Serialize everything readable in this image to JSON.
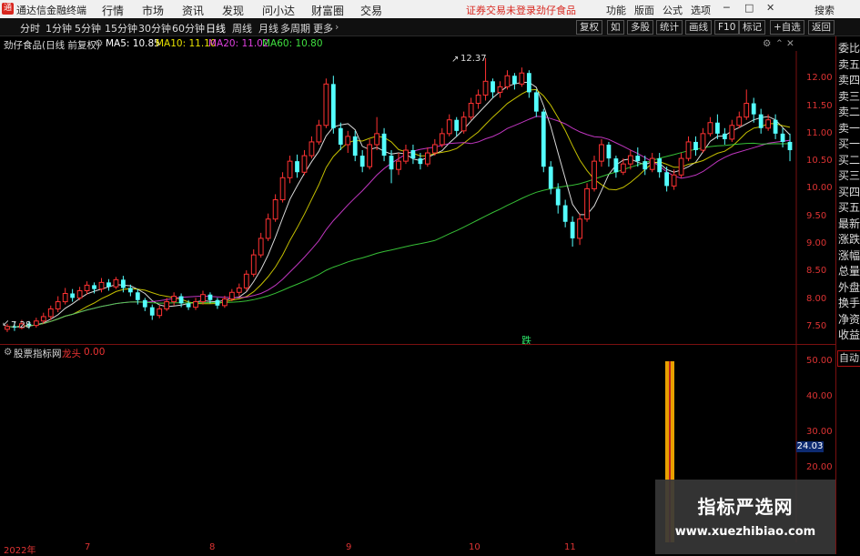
{
  "topbar": {
    "brand": "通达信金融终端",
    "menu": [
      "行情",
      "市场",
      "资讯",
      "发现",
      "问小达",
      "财富圈",
      "交易"
    ],
    "notice": "证券交易未登录",
    "stock": "劲仔食品",
    "right_menu": [
      "功能",
      "版面",
      "公式",
      "选项"
    ],
    "window_controls": [
      "─",
      "□",
      "✕"
    ],
    "search_label": "搜索"
  },
  "toolbar": {
    "periods": [
      "分时",
      "1分钟",
      "5分钟",
      "15分钟",
      "30分钟",
      "60分钟",
      "日线",
      "周线",
      "月线",
      "多周期",
      "更多"
    ],
    "active_period": "日线",
    "right_buttons": [
      "复权",
      "如",
      "多股",
      "统计",
      "画线",
      "F10",
      "标记",
      "+自选",
      "返回"
    ]
  },
  "infobar": {
    "title": "劲仔食品(日线 前复权)",
    "ma5": "MA5: 10.85",
    "ma10": "MA10: 11.10",
    "ma20": "MA20: 11.02",
    "ma60": "MA60: 10.80",
    "colors": {
      "ma5": "#ffffff",
      "ma10": "#e6e000",
      "ma20": "#e040e0",
      "ma60": "#40e040"
    }
  },
  "sidepanel": {
    "items": [
      "委比",
      "卖五",
      "卖四",
      "卖三",
      "卖二",
      "卖一",
      "买一",
      "买二",
      "买三",
      "买四",
      "买五",
      "最新",
      "涨跌",
      "涨幅",
      "总量",
      "外盘",
      "换手",
      "净资",
      "收益"
    ],
    "auto": "自动"
  },
  "price_axis": [
    "12.00",
    "11.50",
    "11.00",
    "10.50",
    "10.00",
    "9.50",
    "9.00",
    "8.50",
    "8.00",
    "7.50"
  ],
  "annotations": {
    "high": "12.37",
    "low": "7.28",
    "signal": "跌"
  },
  "indicator": {
    "name": "股票指标网",
    "param": "龙头",
    "value": "0.00",
    "axis": [
      "50.00",
      "40.00",
      "30.00",
      "20.00"
    ],
    "current_label": "24.03",
    "bar_value": 50
  },
  "x_axis": [
    "2022年",
    "7",
    "8",
    "9",
    "10",
    "11"
  ],
  "watermark": {
    "title": "指标严选网",
    "url": "www.xuezhibiao.com"
  },
  "chart_data": {
    "type": "candlestick",
    "ylim": [
      7.2,
      12.5
    ],
    "candles": [
      [
        7.45,
        7.5,
        7.4,
        7.55
      ],
      [
        7.5,
        7.48,
        7.42,
        7.58
      ],
      [
        7.48,
        7.55,
        7.45,
        7.62
      ],
      [
        7.55,
        7.52,
        7.46,
        7.6
      ],
      [
        7.52,
        7.6,
        7.48,
        7.66
      ],
      [
        7.6,
        7.68,
        7.55,
        7.75
      ],
      [
        7.68,
        7.82,
        7.62,
        7.88
      ],
      [
        7.82,
        7.95,
        7.76,
        8.05
      ],
      [
        7.95,
        8.1,
        7.9,
        8.2
      ],
      [
        8.1,
        8.02,
        7.95,
        8.18
      ],
      [
        8.02,
        8.15,
        7.98,
        8.22
      ],
      [
        8.15,
        8.25,
        8.08,
        8.32
      ],
      [
        8.25,
        8.18,
        8.1,
        8.3
      ],
      [
        8.18,
        8.3,
        8.12,
        8.38
      ],
      [
        8.3,
        8.22,
        8.15,
        8.36
      ],
      [
        8.22,
        8.35,
        8.18,
        8.4
      ],
      [
        8.35,
        8.2,
        8.12,
        8.42
      ],
      [
        8.2,
        8.12,
        8.05,
        8.26
      ],
      [
        8.12,
        7.98,
        7.9,
        8.18
      ],
      [
        7.98,
        7.85,
        7.78,
        8.02
      ],
      [
        7.85,
        7.7,
        7.62,
        7.9
      ],
      [
        7.7,
        7.82,
        7.65,
        7.88
      ],
      [
        7.82,
        7.95,
        7.78,
        8.02
      ],
      [
        7.95,
        8.05,
        7.88,
        8.12
      ],
      [
        8.05,
        7.92,
        7.85,
        8.1
      ],
      [
        7.92,
        7.85,
        7.8,
        7.98
      ],
      [
        7.85,
        7.95,
        7.8,
        8.02
      ],
      [
        7.95,
        8.08,
        7.9,
        8.15
      ],
      [
        8.08,
        7.98,
        7.92,
        8.12
      ],
      [
        7.98,
        7.88,
        7.82,
        8.02
      ],
      [
        7.88,
        8.0,
        7.84,
        8.06
      ],
      [
        8.0,
        8.12,
        7.96,
        8.18
      ],
      [
        8.12,
        8.2,
        8.05,
        8.28
      ],
      [
        8.2,
        8.45,
        8.15,
        8.52
      ],
      [
        8.45,
        8.8,
        8.4,
        8.9
      ],
      [
        8.8,
        9.1,
        8.75,
        9.2
      ],
      [
        9.1,
        9.45,
        9.05,
        9.55
      ],
      [
        9.45,
        9.8,
        9.4,
        9.9
      ],
      [
        9.8,
        10.2,
        9.75,
        10.3
      ],
      [
        10.2,
        10.5,
        10.1,
        10.6
      ],
      [
        10.5,
        10.3,
        10.2,
        10.62
      ],
      [
        10.3,
        10.6,
        10.25,
        10.7
      ],
      [
        10.6,
        10.85,
        10.55,
        10.95
      ],
      [
        10.85,
        11.15,
        10.8,
        11.25
      ],
      [
        11.15,
        11.9,
        11.1,
        12.0
      ],
      [
        11.9,
        11.1,
        11.0,
        12.05
      ],
      [
        11.1,
        10.8,
        10.7,
        11.2
      ],
      [
        10.8,
        10.95,
        10.65,
        11.05
      ],
      [
        10.95,
        10.6,
        10.5,
        11.05
      ],
      [
        10.6,
        10.4,
        10.3,
        10.7
      ],
      [
        10.4,
        10.8,
        10.35,
        10.9
      ],
      [
        10.8,
        11.0,
        10.7,
        11.3
      ],
      [
        11.0,
        10.6,
        10.5,
        11.1
      ],
      [
        10.6,
        10.35,
        10.1,
        10.7
      ],
      [
        10.35,
        10.5,
        10.25,
        10.65
      ],
      [
        10.5,
        10.7,
        10.45,
        10.8
      ],
      [
        10.7,
        10.55,
        10.45,
        10.8
      ],
      [
        10.55,
        10.45,
        10.35,
        10.65
      ],
      [
        10.45,
        10.65,
        10.4,
        10.75
      ],
      [
        10.65,
        10.8,
        10.6,
        10.9
      ],
      [
        10.8,
        11.0,
        10.75,
        11.1
      ],
      [
        11.0,
        11.25,
        10.95,
        11.35
      ],
      [
        11.25,
        11.05,
        10.95,
        11.3
      ],
      [
        11.05,
        11.3,
        11.0,
        11.4
      ],
      [
        11.3,
        11.55,
        11.25,
        11.65
      ],
      [
        11.55,
        11.7,
        11.45,
        11.8
      ],
      [
        11.7,
        11.95,
        11.6,
        12.37
      ],
      [
        11.95,
        11.75,
        11.65,
        12.0
      ],
      [
        11.75,
        11.85,
        11.65,
        11.95
      ],
      [
        11.85,
        12.05,
        11.8,
        12.15
      ],
      [
        12.05,
        11.9,
        11.8,
        12.1
      ],
      [
        11.9,
        12.1,
        11.85,
        12.2
      ],
      [
        12.1,
        11.75,
        11.65,
        12.15
      ],
      [
        11.75,
        11.4,
        11.3,
        11.8
      ],
      [
        11.4,
        10.4,
        10.3,
        11.45
      ],
      [
        10.4,
        10.0,
        9.9,
        10.5
      ],
      [
        10.0,
        9.7,
        9.55,
        10.1
      ],
      [
        9.7,
        9.4,
        9.3,
        9.8
      ],
      [
        9.4,
        9.1,
        8.95,
        9.5
      ],
      [
        9.1,
        9.45,
        8.98,
        9.55
      ],
      [
        9.45,
        10.0,
        9.4,
        10.1
      ],
      [
        10.0,
        10.5,
        9.95,
        10.6
      ],
      [
        10.5,
        10.8,
        10.4,
        10.9
      ],
      [
        10.8,
        10.55,
        10.4,
        10.85
      ],
      [
        10.55,
        10.3,
        10.2,
        10.6
      ],
      [
        10.3,
        10.45,
        10.25,
        10.55
      ],
      [
        10.45,
        10.6,
        10.35,
        10.7
      ],
      [
        10.6,
        10.5,
        10.4,
        10.75
      ],
      [
        10.5,
        10.35,
        10.25,
        10.6
      ],
      [
        10.35,
        10.55,
        10.3,
        10.65
      ],
      [
        10.55,
        10.3,
        10.2,
        10.65
      ],
      [
        10.3,
        10.05,
        9.95,
        10.4
      ],
      [
        10.05,
        10.25,
        9.98,
        10.35
      ],
      [
        10.25,
        10.55,
        10.2,
        10.65
      ],
      [
        10.55,
        10.85,
        10.5,
        10.95
      ],
      [
        10.85,
        10.7,
        10.6,
        10.95
      ],
      [
        10.7,
        11.0,
        10.65,
        11.1
      ],
      [
        11.0,
        11.2,
        10.95,
        11.3
      ],
      [
        11.2,
        11.0,
        10.9,
        11.35
      ],
      [
        11.0,
        10.9,
        10.8,
        11.1
      ],
      [
        10.9,
        11.15,
        10.85,
        11.25
      ],
      [
        11.15,
        11.3,
        11.1,
        11.4
      ],
      [
        11.3,
        11.55,
        11.25,
        11.8
      ],
      [
        11.55,
        11.35,
        11.2,
        11.65
      ],
      [
        11.35,
        11.1,
        11.0,
        11.45
      ],
      [
        11.1,
        11.25,
        11.05,
        11.35
      ],
      [
        11.25,
        11.0,
        10.9,
        11.35
      ],
      [
        11.0,
        10.85,
        10.75,
        11.1
      ],
      [
        10.85,
        10.7,
        10.5,
        11.0
      ]
    ]
  }
}
